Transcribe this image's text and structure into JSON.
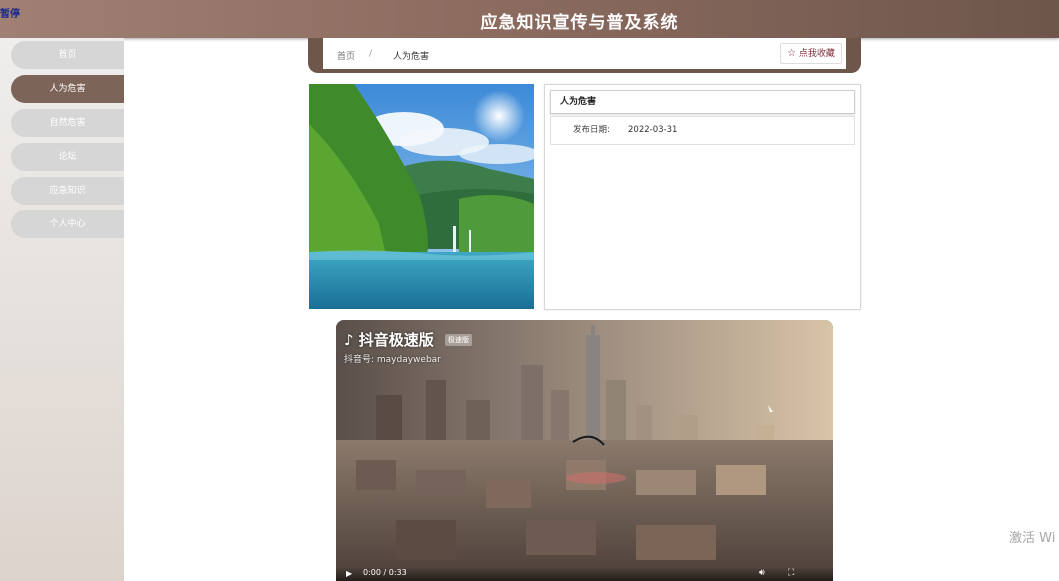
{
  "header": {
    "corner_text": "暂停",
    "title": "应急知识宣传与普及系统"
  },
  "sidebar": {
    "items": [
      {
        "label": "首页",
        "active": false
      },
      {
        "label": "人为危害",
        "active": true
      },
      {
        "label": "自然危害",
        "active": false
      },
      {
        "label": "论坛",
        "active": false
      },
      {
        "label": "应急知识",
        "active": false
      },
      {
        "label": "个人中心",
        "active": false
      }
    ]
  },
  "breadcrumb": {
    "home": "首页",
    "separator": "/",
    "current": "人为危害",
    "favorite_label": "点我收藏",
    "favorite_icon": "star-outline-icon"
  },
  "detail": {
    "title": "人为危害",
    "date_label": "发布日期:",
    "date_value": "2022-03-31"
  },
  "video": {
    "brand": "抖音极速版",
    "badge": "极速版",
    "account": "抖音号: maydaywebar",
    "time": "0:00 / 0:33",
    "play_icon": "play-icon",
    "volume_icon": "volume-icon",
    "fullscreen_icon": "fullscreen-icon"
  },
  "watermark": "激活 Wi",
  "colors": {
    "header_brown": "#8d6c60",
    "active_nav": "#7d6459",
    "inactive_nav": "#d6d6d6",
    "favorite_text": "#7d2f3a"
  }
}
